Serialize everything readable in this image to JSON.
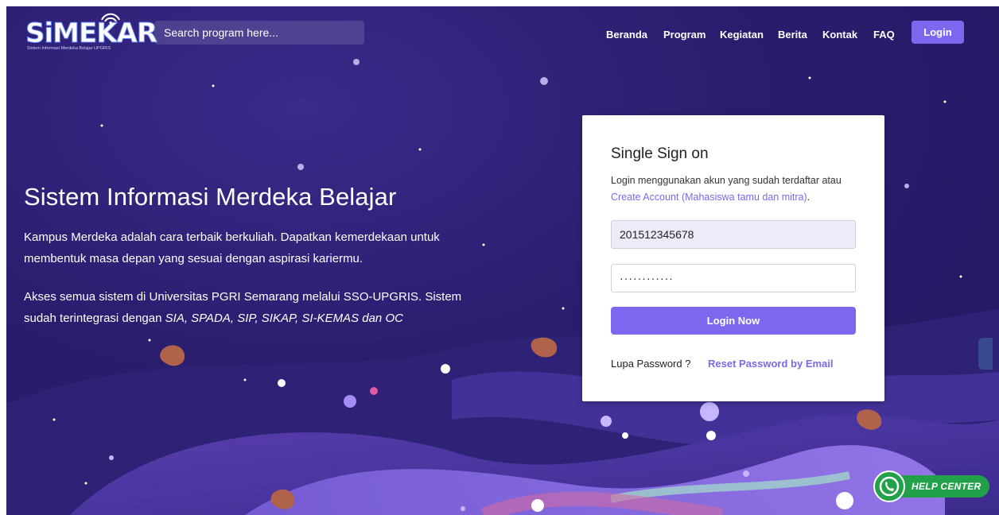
{
  "brand": {
    "logo_text": "SiMEKAR",
    "logo_subtitle": "Sistem Informasi Merdeka Belajar UPGRIS"
  },
  "search": {
    "placeholder": "Search program here..."
  },
  "nav": {
    "items": [
      "Beranda",
      "Program",
      "Kegiatan",
      "Berita",
      "Kontak",
      "FAQ"
    ],
    "login_label": "Login"
  },
  "hero": {
    "title": "Sistem Informasi Merdeka Belajar",
    "paragraph1": "Kampus Merdeka adalah cara terbaik berkuliah. Dapatkan kemerdekaan untuk membentuk masa depan yang sesuai dengan aspirasi kariermu.",
    "paragraph2_prefix": "Akses semua sistem di Universitas PGRI Semarang melalui SSO-UPGRIS. Sistem sudah terintegrasi dengan ",
    "paragraph2_systems": "SIA, SPADA, SIP, SIKAP, SI-KEMAS dan OC"
  },
  "sso": {
    "title": "Single Sign on",
    "description": "Login menggunakan akun yang sudah terdaftar atau",
    "create_account_link": "Create Account (Mahasiswa tamu dan mitra)",
    "create_account_suffix": ".",
    "username_value": "201512345678",
    "password_value": "············",
    "login_button": "Login Now",
    "forgot_label": "Lupa Password ?",
    "reset_link": "Reset Password by Email"
  },
  "help_center": {
    "label": "HELP CENTER"
  },
  "colors": {
    "accent": "#7b68ee",
    "background": "#2a1d6e",
    "whatsapp": "#23a14a"
  }
}
